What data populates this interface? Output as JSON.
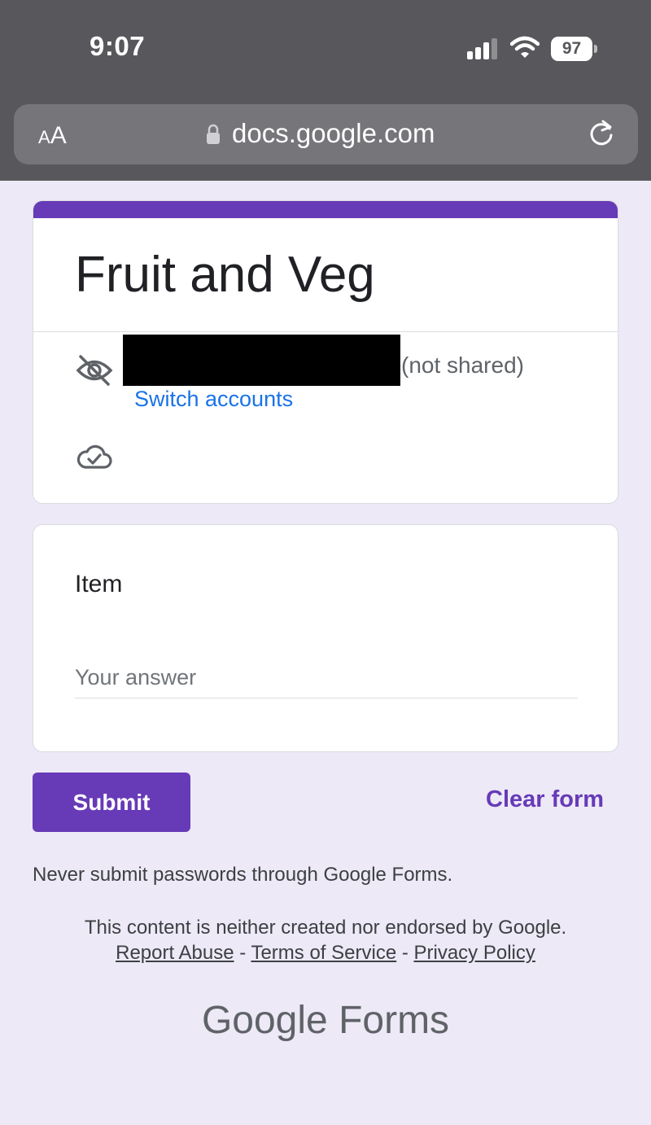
{
  "status_bar": {
    "time": "9:07",
    "battery": "97"
  },
  "browser": {
    "text_size_label_small": "A",
    "text_size_label_large": "A",
    "url": "docs.google.com"
  },
  "form": {
    "title": "Fruit and Veg",
    "account_status": "(not shared)",
    "switch_accounts": "Switch accounts",
    "question_label": "Item",
    "answer_placeholder": "Your answer",
    "submit_label": "Submit",
    "clear_label": "Clear form"
  },
  "footer": {
    "password_warning": "Never submit passwords through Google Forms.",
    "disclaimer": "This content is neither created nor endorsed by Google.",
    "report_abuse": "Report Abuse",
    "terms": "Terms of Service",
    "privacy": "Privacy Policy",
    "separator": " - ",
    "brand_google": "Google",
    "brand_product": "Forms"
  },
  "colors": {
    "accent": "#673ab7",
    "link": "#1a73e8",
    "background": "#ede9f6"
  },
  "icons": [
    "signal-icon",
    "wifi-icon",
    "battery-icon",
    "lock-icon",
    "reload-icon",
    "eye-off-icon",
    "cloud-check-icon"
  ]
}
